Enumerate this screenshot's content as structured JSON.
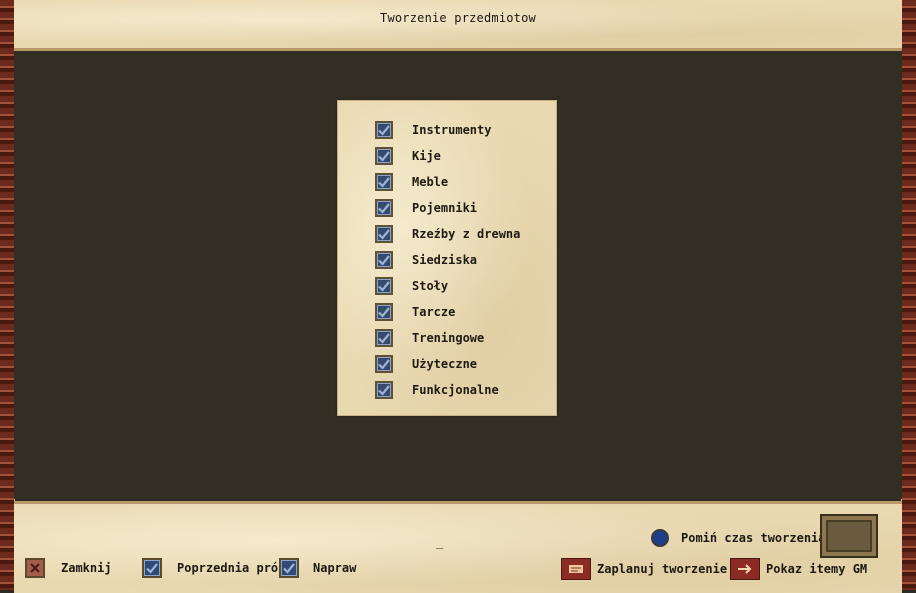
{
  "window": {
    "title": "Tworzenie przedmiotow"
  },
  "categories": [
    {
      "label": "Instrumenty",
      "checked": true
    },
    {
      "label": "Kije",
      "checked": true
    },
    {
      "label": "Meble",
      "checked": true
    },
    {
      "label": "Pojemniki",
      "checked": true
    },
    {
      "label": "Rzeźby z drewna",
      "checked": true
    },
    {
      "label": "Siedziska",
      "checked": true
    },
    {
      "label": "Stoły",
      "checked": true
    },
    {
      "label": "Tarcze",
      "checked": true
    },
    {
      "label": "Treningowe",
      "checked": true
    },
    {
      "label": "Użyteczne",
      "checked": true
    },
    {
      "label": "Funkcjonalne",
      "checked": true
    }
  ],
  "bottom": {
    "status_text": "_",
    "skip_time_label": "Pomiń czas tworzenia",
    "close_label": "Zamknij",
    "previous_attempt_label": "Poprzednia próba",
    "repair_label": "Napraw",
    "schedule_label": "Zaplanuj tworzenie",
    "show_gm_label": "Pokaz itemy GM"
  },
  "colors": {
    "parchment": "#e9d9b1",
    "main_bg": "#322e24",
    "checkbox_blue": "#354a6c",
    "frame_red": "#6b2a1c"
  }
}
